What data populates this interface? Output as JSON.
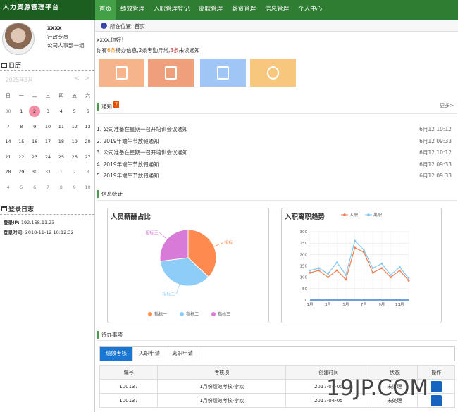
{
  "app": {
    "logo": "人力资源管理平台"
  },
  "nav": [
    "首页",
    "绩效管理",
    "入职管理登记",
    "离职管理",
    "薪资管理",
    "信息管理",
    "个人中心"
  ],
  "user": {
    "name": "xxxx",
    "role": "行政专员",
    "dept": "公司人事部一组"
  },
  "calendar": {
    "title": "日历",
    "month": "2025年3月",
    "prev": "<",
    "next": ">",
    "weekdays": [
      "日",
      "一",
      "二",
      "三",
      "四",
      "五",
      "六"
    ],
    "days": [
      {
        "d": "30",
        "dim": true
      },
      {
        "d": "1"
      },
      {
        "d": "2",
        "today": true
      },
      {
        "d": "3"
      },
      {
        "d": "4"
      },
      {
        "d": "5"
      },
      {
        "d": "6"
      },
      {
        "d": "7"
      },
      {
        "d": "8"
      },
      {
        "d": "9"
      },
      {
        "d": "10"
      },
      {
        "d": "11"
      },
      {
        "d": "12"
      },
      {
        "d": "13"
      },
      {
        "d": "14"
      },
      {
        "d": "15"
      },
      {
        "d": "16"
      },
      {
        "d": "17"
      },
      {
        "d": "18"
      },
      {
        "d": "19"
      },
      {
        "d": "20"
      },
      {
        "d": "21"
      },
      {
        "d": "22"
      },
      {
        "d": "23"
      },
      {
        "d": "24"
      },
      {
        "d": "25"
      },
      {
        "d": "26"
      },
      {
        "d": "27"
      },
      {
        "d": "28"
      },
      {
        "d": "29"
      },
      {
        "d": "30"
      },
      {
        "d": "31"
      },
      {
        "d": "1",
        "dim": true
      },
      {
        "d": "2",
        "dim": true
      },
      {
        "d": "3",
        "dim": true
      },
      {
        "d": "4",
        "dim": true
      },
      {
        "d": "5",
        "dim": true
      },
      {
        "d": "6",
        "dim": true
      },
      {
        "d": "7",
        "dim": true
      },
      {
        "d": "8",
        "dim": true
      },
      {
        "d": "9",
        "dim": true
      },
      {
        "d": "10",
        "dim": true
      }
    ]
  },
  "login": {
    "title": "登录日志",
    "ip_label": "登录IP:",
    "ip": "192.168.11.23",
    "time_label": "登录时间:",
    "time": "2018-11-12 10:12:32"
  },
  "breadcrumb": {
    "label": "所在位置:",
    "current": "首页"
  },
  "greeting": "xxxx,你好！",
  "summary": {
    "pre": "你有",
    "pending": "6条",
    "mid1": "待办信息,",
    "attendance": "2条",
    "mid2": "考勤异常,",
    "unread": "3条",
    "post": "未读通知"
  },
  "tiles": [
    {
      "icon": "clipboard-check-icon",
      "color": "#f5b48c"
    },
    {
      "icon": "clipboard-person-icon",
      "color": "#ef9f7c"
    },
    {
      "icon": "edit-icon",
      "color": "#9fc6f4"
    },
    {
      "icon": "award-icon",
      "color": "#f8c77e"
    }
  ],
  "notices": {
    "title": "通知",
    "badge": "7",
    "more": "更多>",
    "items": [
      {
        "text": "1. 公司准备在星期一召开培训会议通知",
        "date": "6月12 10:12"
      },
      {
        "text": "2. 2019年端午节放假通知",
        "date": "6月12 09:33"
      },
      {
        "text": "3. 公司准备在星期一召开培训会议通知",
        "date": "6月12 10:12"
      },
      {
        "text": "4. 2019年端午节放假通知",
        "date": "6月12 09:33"
      },
      {
        "text": "5. 2019年端午节放假通知",
        "date": "6月12 09:33"
      }
    ]
  },
  "stats": {
    "title": "信息统计"
  },
  "chart_data": [
    {
      "type": "pie",
      "title": "人员薪酬占比",
      "labels": [
        "指标一",
        "指标二",
        "指标三"
      ],
      "values": [
        37,
        36,
        27
      ],
      "colors": [
        "#ff8a50",
        "#8ecdf8",
        "#d77ad8"
      ],
      "legend": "bottom"
    },
    {
      "type": "line",
      "title": "入职离职趋势",
      "x": [
        "1月",
        "2月",
        "3月",
        "4月",
        "5月",
        "6月",
        "7月",
        "8月",
        "9月",
        "10月",
        "11月",
        "12月"
      ],
      "xticks": [
        "1月",
        "3月",
        "5月",
        "7月",
        "9月",
        "11月"
      ],
      "ylim": [
        0,
        300
      ],
      "yticks": [
        0,
        50,
        100,
        150,
        200,
        250,
        300
      ],
      "series": [
        {
          "name": "入职",
          "color": "#f07d4e",
          "values": [
            120,
            130,
            100,
            130,
            90,
            230,
            210,
            120,
            140,
            100,
            130,
            85
          ]
        },
        {
          "name": "离职",
          "color": "#85c6ef",
          "values": [
            130,
            140,
            115,
            165,
            110,
            260,
            220,
            140,
            160,
            110,
            145,
            95
          ]
        }
      ],
      "legend": "top"
    }
  ],
  "todo": {
    "title": "待办事项",
    "tabs": [
      "绩效考核",
      "入职申请",
      "离职申请"
    ],
    "columns": [
      "编号",
      "考核项",
      "创建时间",
      "状态",
      "操作"
    ],
    "rows": [
      {
        "id": "100137",
        "item": "1月份绩效考核-李欢",
        "time": "2017-04-05",
        "status": "未处理"
      },
      {
        "id": "100137",
        "item": "1月份绩效考核-李欢",
        "time": "2017-04-05",
        "status": "未处理"
      }
    ]
  },
  "watermark": "19JP.COM"
}
